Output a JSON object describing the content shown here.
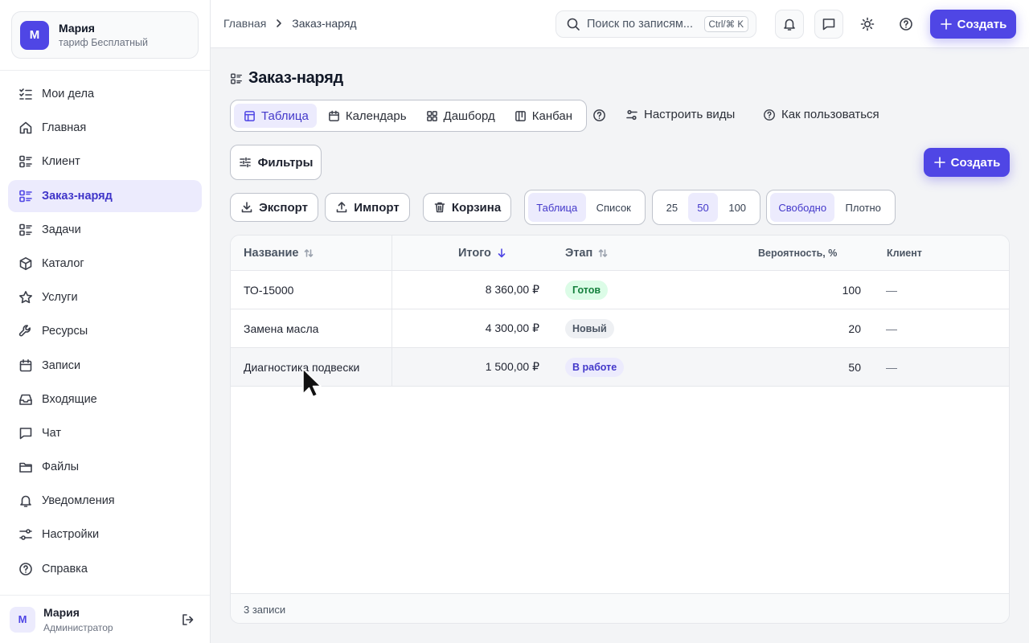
{
  "colors": {
    "accent": "#4f46e5",
    "accent_soft": "#ecebfd",
    "ready": "#15803d",
    "ready_bg": "#dcfce7",
    "new_bg": "#eef0f3",
    "progress_bg": "#ecebfd"
  },
  "profile": {
    "initial": "M",
    "name": "Мария",
    "plan": "тариф Бесплатный"
  },
  "sidebar": {
    "items": [
      {
        "label": "Мои дела",
        "icon": "checklist-icon"
      },
      {
        "label": "Главная",
        "icon": "home-icon"
      },
      {
        "label": "Клиент",
        "icon": "list-icon"
      },
      {
        "label": "Заказ-наряд",
        "icon": "list-icon",
        "active": true
      },
      {
        "label": "Задачи",
        "icon": "list-icon"
      },
      {
        "label": "Каталог",
        "icon": "box-icon"
      },
      {
        "label": "Услуги",
        "icon": "star-icon"
      },
      {
        "label": "Ресурсы",
        "icon": "wrench-icon"
      },
      {
        "label": "Записи",
        "icon": "calendar-icon"
      },
      {
        "label": "Входящие",
        "icon": "inbox-icon"
      },
      {
        "label": "Чат",
        "icon": "chat-icon"
      },
      {
        "label": "Файлы",
        "icon": "folder-icon"
      },
      {
        "label": "Уведомления",
        "icon": "bell-icon"
      },
      {
        "label": "Настройки",
        "icon": "sliders-icon"
      },
      {
        "label": "Справка",
        "icon": "help-icon"
      }
    ]
  },
  "footer": {
    "initial": "M",
    "name": "Мария",
    "role": "Администратор"
  },
  "header": {
    "breadcrumb": [
      "Главная",
      "Заказ-наряд"
    ],
    "search_placeholder": "Поиск по записям...",
    "search_shortcut": "Ctrl/⌘ K",
    "create_label": "Создать"
  },
  "main": {
    "title": "Заказ-наряд",
    "views": [
      "Таблица",
      "Календарь",
      "Дашборд",
      "Канбан"
    ],
    "configure_views": "Настроить виды",
    "how_to_use": "Как пользоваться",
    "filters": "Фильтры",
    "create_label": "Создать",
    "export": "Экспорт",
    "import": "Импорт",
    "trash": "Корзина",
    "layout_modes": [
      "Таблица",
      "Список"
    ],
    "page_sizes": [
      "25",
      "50",
      "100"
    ],
    "density": [
      "Свободно",
      "Плотно"
    ]
  },
  "table": {
    "columns": [
      "Название",
      "Итого",
      "Этап",
      "Вероятность, %",
      "Клиент"
    ],
    "rows": [
      {
        "name": "ТО-15000",
        "total": "8 360,00 ₽",
        "stage": "Готов",
        "probability": "100",
        "client": "—"
      },
      {
        "name": "Замена масла",
        "total": "4 300,00 ₽",
        "stage": "Новый",
        "probability": "20",
        "client": "—"
      },
      {
        "name": "Диагностика подвески",
        "total": "1 500,00 ₽",
        "stage": "В работе",
        "probability": "50",
        "client": "—"
      }
    ],
    "footer": "3 записи"
  }
}
